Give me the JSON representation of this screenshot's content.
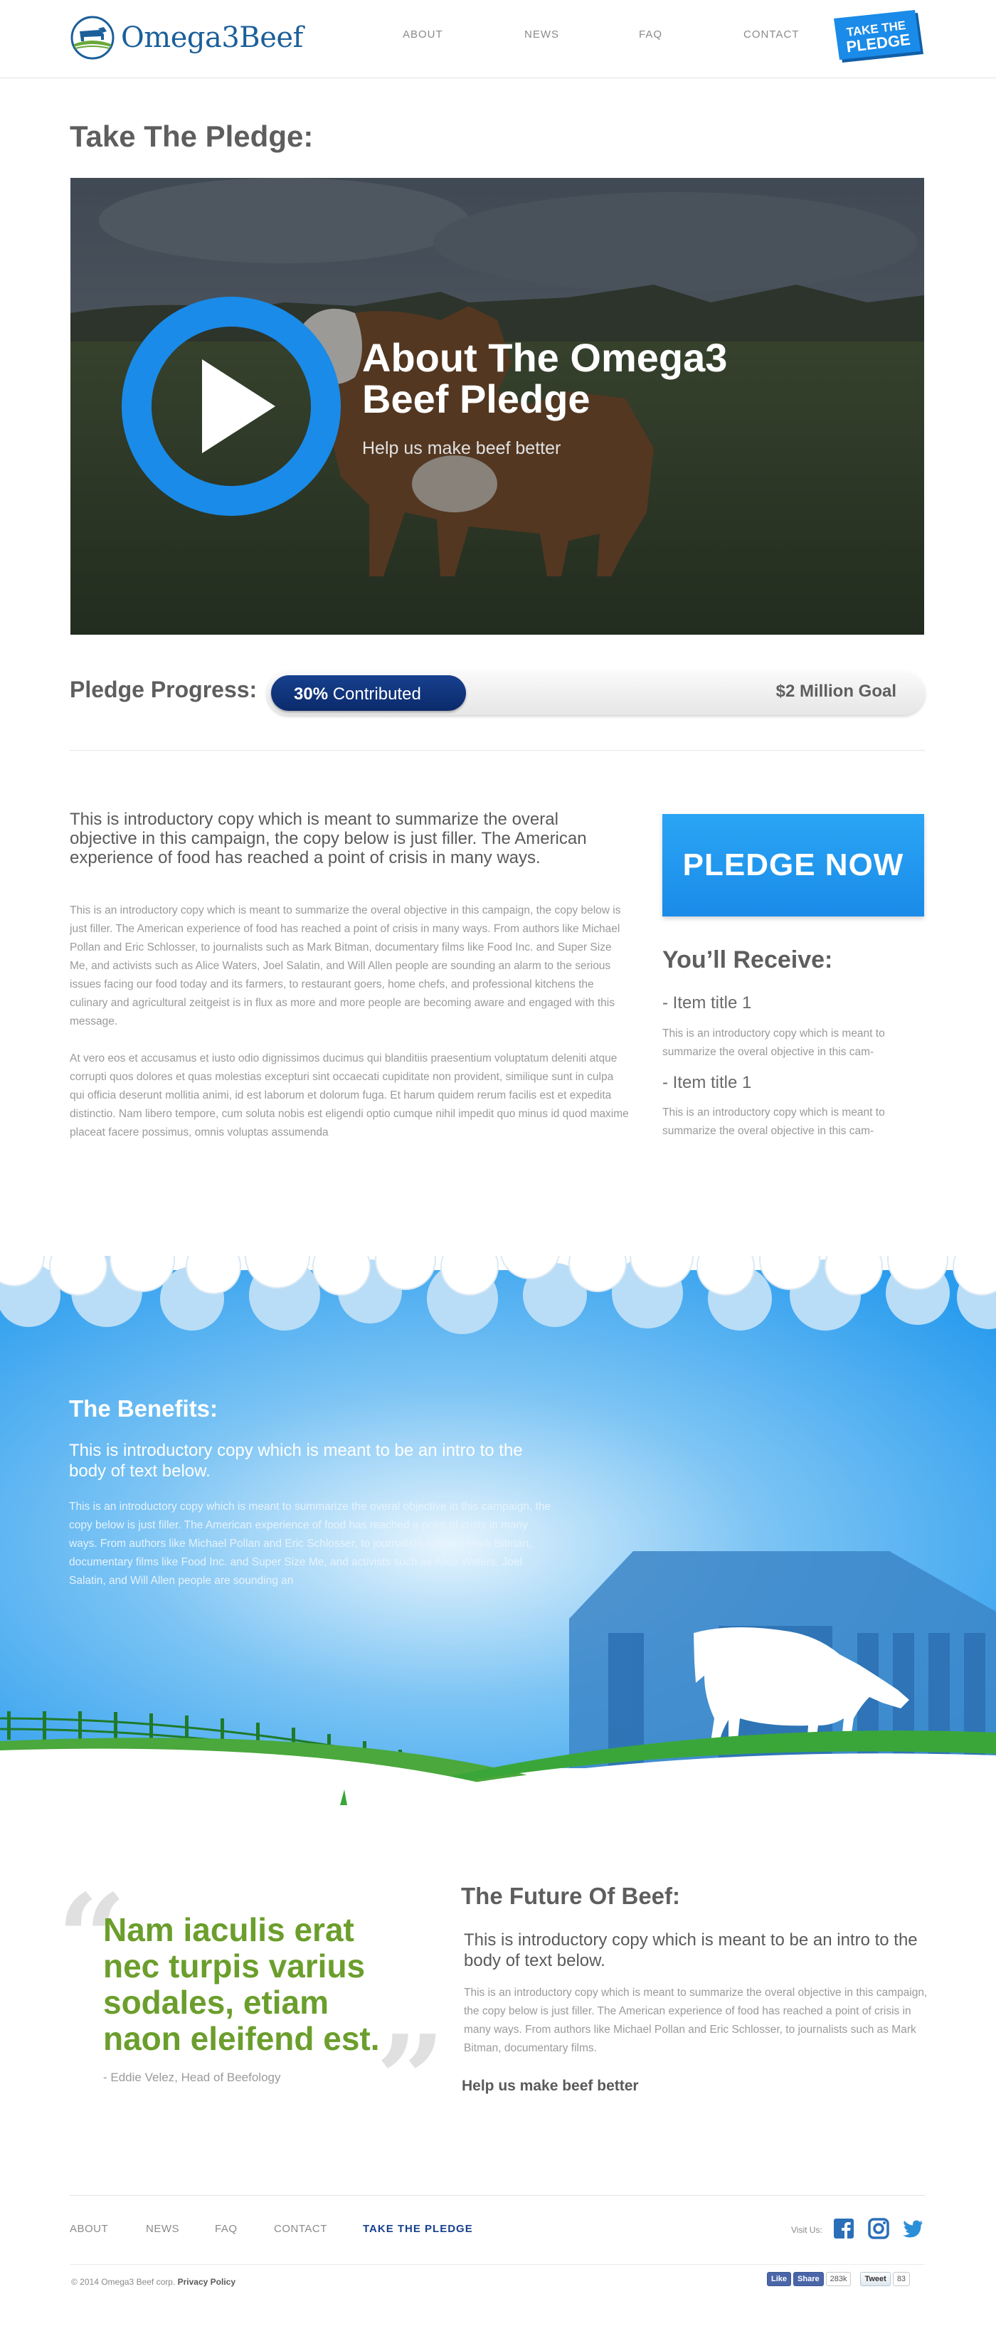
{
  "header": {
    "logo_text": "Omega3Beef",
    "nav": [
      "ABOUT",
      "NEWS",
      "FAQ",
      "CONTACT"
    ],
    "badge_line1": "TAKE THE",
    "badge_line2": "PLEDGE"
  },
  "page_title": "Take The Pledge:",
  "video": {
    "title": "About The Omega3 Beef Pledge",
    "subtitle": "Help us make beef better"
  },
  "progress": {
    "label": "Pledge Progress:",
    "percent": 30,
    "percent_text": "30%",
    "contributed_label": "Contributed",
    "goal": "$2 Million Goal"
  },
  "intro": {
    "lead": "This is introductory copy which is meant to summarize the overal objective in this campaign, the copy below is just filler. The American experience of food has reached a point of crisis in many ways.",
    "p1": "This is an introductory copy which is meant to summarize the overal objective in this campaign, the copy below is just filler. The American experience of food has reached a point of crisis in many ways. From authors like Michael Pollan and Eric Schlosser, to journalists such as Mark Bitman, documentary films like Food Inc. and Super Size Me, and activists such as Alice Waters, Joel Salatin, and Will Allen people are sounding an alarm to the serious issues facing our food today and its farmers, to restaurant goers, home chefs, and professional kitchens the culinary and agricultural zeitgeist is in flux as more and more people are becoming aware and engaged with this message.",
    "p2": "At vero eos et accusamus et iusto odio dignissimos ducimus qui blanditiis praesentium voluptatum deleniti atque corrupti quos dolores et quas molestias excepturi sint occaecati cupiditate non provident, similique sunt in culpa qui officia deserunt mollitia animi, id est laborum et dolorum fuga. Et harum quidem rerum facilis est et expedita distinctio. Nam libero tempore, cum soluta nobis est eligendi optio cumque nihil impedit quo minus id quod maxime placeat facere possimus, omnis voluptas assumenda"
  },
  "sidebar": {
    "pledge_button": "PLEDGE NOW",
    "receive_title": "You’ll Receive:",
    "items": [
      {
        "title": "- Item title 1",
        "desc": "This is an introductory copy which is meant to summarize the overal objective in this cam-"
      },
      {
        "title": "- Item title 1",
        "desc": "This is an introductory copy which is meant to summarize the overal objective in this cam-"
      }
    ]
  },
  "benefits": {
    "title": "The Benefits:",
    "lead": "This is introductory copy which is meant to be an intro to the body of text below.",
    "body": "This is an introductory copy which is meant to summarize the overal objective in this campaign, the copy below is just filler. The American experience of food has reached a point of crisis in many ways. From authors like Michael Pollan and Eric Schlosser, to journalists such as Mark Bitman, documentary films like Food Inc. and Super Size Me, and activists such as Alice Waters, Joel Salatin, and Will Allen people are sounding an"
  },
  "quote": {
    "open_mark": "“",
    "close_mark": "”",
    "text": "Nam iaculis erat nec turpis varius sodales, etiam naon eleifend est.",
    "author": "- Eddie Velez, Head of Beefology"
  },
  "future": {
    "title": "The Future Of Beef:",
    "lead": "This is introductory copy which is meant to be an intro to the body of text below.",
    "body": "This is an introductory copy which is meant to summarize the overal objective in this campaign, the copy below is just filler. The American experience of food has reached a point of crisis in many ways. From authors like Michael Pollan and Eric Schlosser, to journalists such as Mark Bitman, documentary films.",
    "link": "Help us make beef better"
  },
  "footer": {
    "nav": [
      "ABOUT",
      "NEWS",
      "FAQ",
      "CONTACT",
      "TAKE THE PLEDGE"
    ],
    "visit_us": "Visit Us:",
    "copyright": "© 2014 Omega3 Beef corp.",
    "privacy": "Privacy Policy",
    "share": {
      "like": "Like",
      "share": "Share",
      "like_count": "283k",
      "tweet": "Tweet",
      "tweet_count": "83"
    }
  },
  "colors": {
    "brand_blue": "#1b5f9a",
    "accent_blue": "#1a8be8",
    "progress_navy": "#17408e",
    "quote_green": "#6b9e2c",
    "grass_green": "#3aa63a"
  },
  "icons": [
    "logo-cow-icon",
    "play-icon",
    "facebook-icon",
    "instagram-icon",
    "twitter-icon"
  ]
}
